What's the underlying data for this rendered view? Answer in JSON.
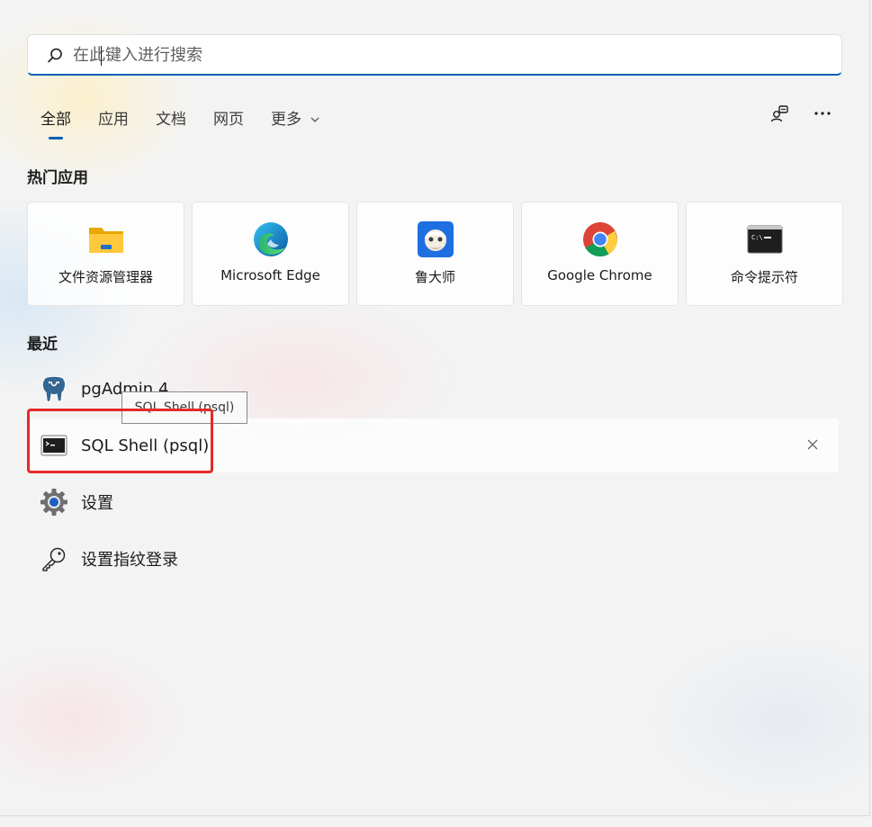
{
  "search": {
    "placeholder": "在此键入进行搜索",
    "value": ""
  },
  "tabs": [
    {
      "label": "全部",
      "active": true
    },
    {
      "label": "应用"
    },
    {
      "label": "文档"
    },
    {
      "label": "网页"
    },
    {
      "label": "更多"
    }
  ],
  "top_right": {
    "icons": [
      "account-switch-icon",
      "more-options-icon"
    ]
  },
  "sections": {
    "popular_title": "热门应用",
    "recent_title": "最近"
  },
  "popular_apps": [
    {
      "label": "文件资源管理器",
      "icon": "file-explorer-icon"
    },
    {
      "label": "Microsoft Edge",
      "icon": "edge-icon"
    },
    {
      "label": "鲁大师",
      "icon": "ludashi-icon"
    },
    {
      "label": "Google Chrome",
      "icon": "chrome-icon"
    },
    {
      "label": "命令提示符",
      "icon": "command-prompt-icon"
    }
  ],
  "recent": [
    {
      "label": "pgAdmin 4",
      "icon": "pgadmin-elephant-icon"
    },
    {
      "label": "SQL Shell (psql)",
      "icon": "terminal-icon",
      "hovered": true
    },
    {
      "label": "设置",
      "icon": "settings-gear-icon"
    },
    {
      "label": "设置指纹登录",
      "icon": "key-icon"
    }
  ],
  "tooltip": {
    "text": "SQL Shell (psql)"
  },
  "colors": {
    "accent": "#005fb8",
    "highlight": "#e52a2a",
    "background": "#f3f3f3"
  }
}
